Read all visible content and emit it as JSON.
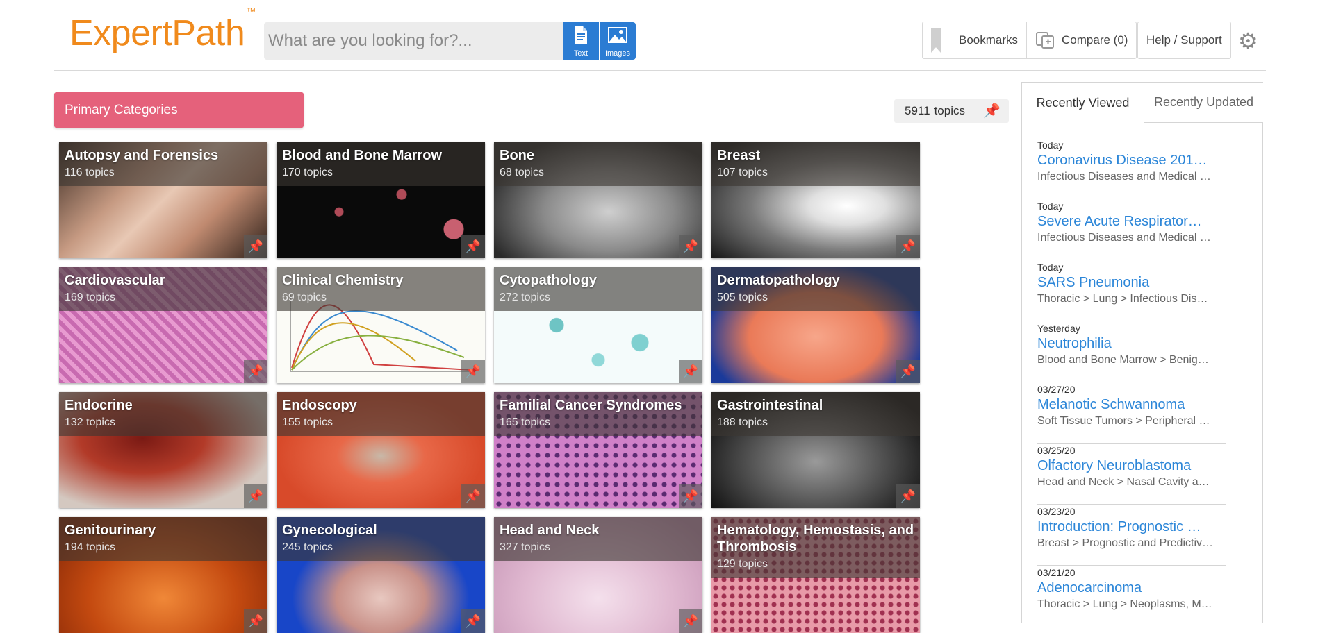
{
  "header": {
    "logo_text": "ExpertPath",
    "logo_tm": "™",
    "search_placeholder": "What are you looking for?...",
    "text_button_label": "Text",
    "images_button_label": "Images",
    "bookmarks_label": "Bookmarks",
    "compare_label": "Compare (0)",
    "help_label": "Help / Support",
    "brand_color": "#f08a1c",
    "accent_color": "#2b7cd3"
  },
  "primary": {
    "banner_label": "Primary Categories",
    "banner_color": "#e5617b",
    "topic_total": "5911",
    "topic_total_suffix": "topics"
  },
  "tiles": [
    {
      "name": "Autopsy and Forensics",
      "count": "116",
      "suffix": "topics"
    },
    {
      "name": "Blood and Bone Marrow",
      "count": "170",
      "suffix": "topics"
    },
    {
      "name": "Bone",
      "count": "68",
      "suffix": "topics"
    },
    {
      "name": "Breast",
      "count": "107",
      "suffix": "topics"
    },
    {
      "name": "Cardiovascular",
      "count": "169",
      "suffix": "topics"
    },
    {
      "name": "Clinical Chemistry",
      "count": "69",
      "suffix": "topics"
    },
    {
      "name": "Cytopathology",
      "count": "272",
      "suffix": "topics"
    },
    {
      "name": "Dermatopathology",
      "count": "505",
      "suffix": "topics"
    },
    {
      "name": "Endocrine",
      "count": "132",
      "suffix": "topics"
    },
    {
      "name": "Endoscopy",
      "count": "155",
      "suffix": "topics"
    },
    {
      "name": "Familial Cancer Syndromes",
      "count": "165",
      "suffix": "topics"
    },
    {
      "name": "Gastrointestinal",
      "count": "188",
      "suffix": "topics"
    },
    {
      "name": "Genitourinary",
      "count": "194",
      "suffix": "topics"
    },
    {
      "name": "Gynecological",
      "count": "245",
      "suffix": "topics"
    },
    {
      "name": "Head and Neck",
      "count": "327",
      "suffix": "topics"
    },
    {
      "name": "Hematology, Hemostasis, and Thrombosis",
      "count": "129",
      "suffix": "topics"
    }
  ],
  "recent": {
    "tab_viewed": "Recently Viewed",
    "tab_updated": "Recently Updated",
    "items": [
      {
        "date": "Today",
        "title": "Coronavirus Disease 201…",
        "path": "Infectious Diseases and Medical …"
      },
      {
        "date": "Today",
        "title": "Severe Acute Respirator…",
        "path": "Infectious Diseases and Medical …"
      },
      {
        "date": "Today",
        "title": "SARS Pneumonia",
        "path": "Thoracic > Lung > Infectious Dis…"
      },
      {
        "date": "Yesterday",
        "title": "Neutrophilia",
        "path": "Blood and Bone Marrow > Benig…"
      },
      {
        "date": "03/27/20",
        "title": "Melanotic Schwannoma",
        "path": "Soft Tissue Tumors > Peripheral …"
      },
      {
        "date": "03/25/20",
        "title": "Olfactory Neuroblastoma",
        "path": "Head and Neck > Nasal Cavity a…"
      },
      {
        "date": "03/23/20",
        "title": "Introduction: Prognostic …",
        "path": "Breast > Prognostic and Predictiv…"
      },
      {
        "date": "03/21/20",
        "title": "Adenocarcinoma",
        "path": "Thoracic > Lung > Neoplasms, M…"
      }
    ]
  }
}
